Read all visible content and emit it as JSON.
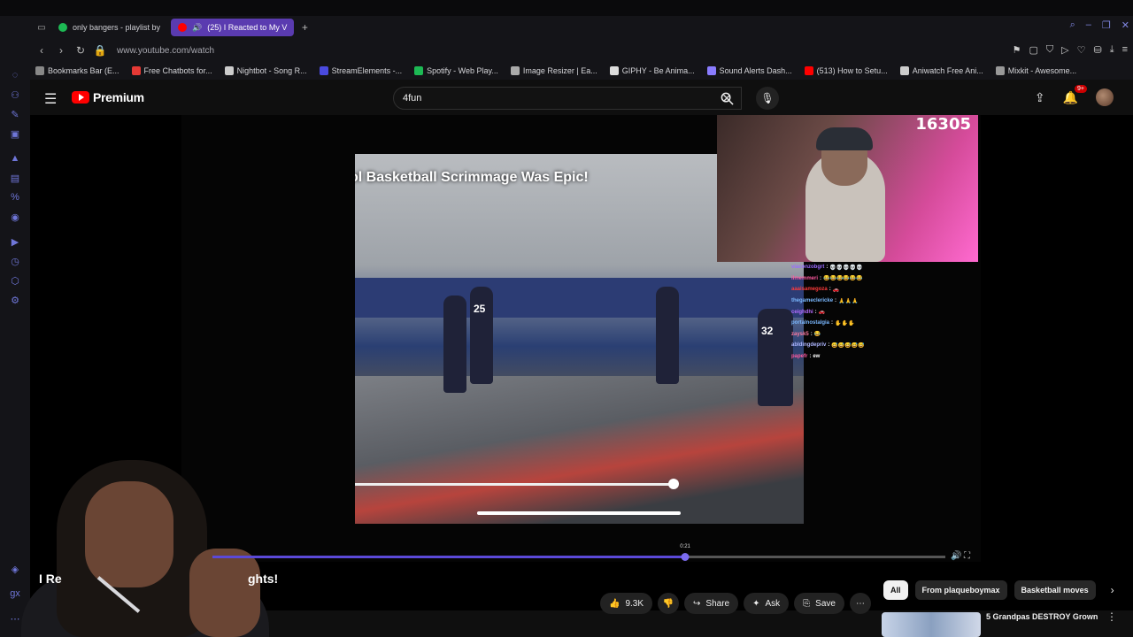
{
  "browser": {
    "tabs": [
      {
        "label": "only bangers - playlist by",
        "active": false,
        "color": "#1db954"
      },
      {
        "label": "(25) I Reacted to My V",
        "active": true,
        "color": "#ff0000"
      }
    ],
    "new_tab_label": "+",
    "url": "www.youtube.com/watch",
    "bookmarks": [
      {
        "label": "Bookmarks Bar (E...",
        "color": "#888888"
      },
      {
        "label": "Free Chatbots for...",
        "color": "#e53935"
      },
      {
        "label": "Nightbot - Song R...",
        "color": "#cccccc"
      },
      {
        "label": "StreamElements -...",
        "color": "#4a4adf"
      },
      {
        "label": "Spotify - Web Play...",
        "color": "#1db954"
      },
      {
        "label": "Image Resizer | Ea...",
        "color": "#aaaaaa"
      },
      {
        "label": "GIPHY - Be Anima...",
        "color": "#dddddd"
      },
      {
        "label": "Sound Alerts Dash...",
        "color": "#8a7cff"
      },
      {
        "label": "(513) How to Setu...",
        "color": "#ff0000"
      },
      {
        "label": "Aniwatch Free Ani...",
        "color": "#cccccc"
      },
      {
        "label": "Mixkit - Awesome...",
        "color": "#999999"
      }
    ]
  },
  "youtube": {
    "logo_text": "Premium",
    "search_value": "4fun",
    "notifications_badge": "9+",
    "video_overlay_title": "ol Basketball Scrimmage Was Epic!",
    "jersey_numbers": [
      "25",
      "32"
    ],
    "viewer_count": "16305",
    "chat": [
      {
        "user": "viaconzobgrt",
        "text": "💀💀💀💀💀",
        "cls": "u1"
      },
      {
        "user": "ilmemmeri",
        "text": "😂😂😂😂😂😂",
        "cls": "u2"
      },
      {
        "user": "aaaisamegoza",
        "text": "🚗",
        "cls": "u3"
      },
      {
        "user": "thegameclericke",
        "text": "🙏🙏🙏",
        "cls": "u4"
      },
      {
        "user": "ceighdhi",
        "text": "🚗",
        "cls": "u5"
      },
      {
        "user": "portalnostalgia",
        "text": "✋✋✋",
        "cls": "u4"
      },
      {
        "user": "zaysk5",
        "text": "😂",
        "cls": "u6"
      },
      {
        "user": "abldingdepriv",
        "text": "😅😅😅😅😅",
        "cls": "u7"
      },
      {
        "user": "papefr",
        "text": "ew",
        "cls": "u2"
      }
    ],
    "progress_fraction": 0.645,
    "time_tooltip": "0:21",
    "video_title_left": "I Re",
    "video_title_right": "ghts!",
    "actions": {
      "likes": "9.3K",
      "share": "Share",
      "ask": "Ask",
      "save": "Save"
    },
    "chips": [
      "All",
      "From plaqueboymax",
      "Basketball moves"
    ],
    "recommendation_title": "5 Grandpas DESTROY Grown",
    "colors": {
      "brand_red": "#ff0000",
      "progress": "#5b49d8",
      "tab_active": "#5a3bb0"
    }
  }
}
